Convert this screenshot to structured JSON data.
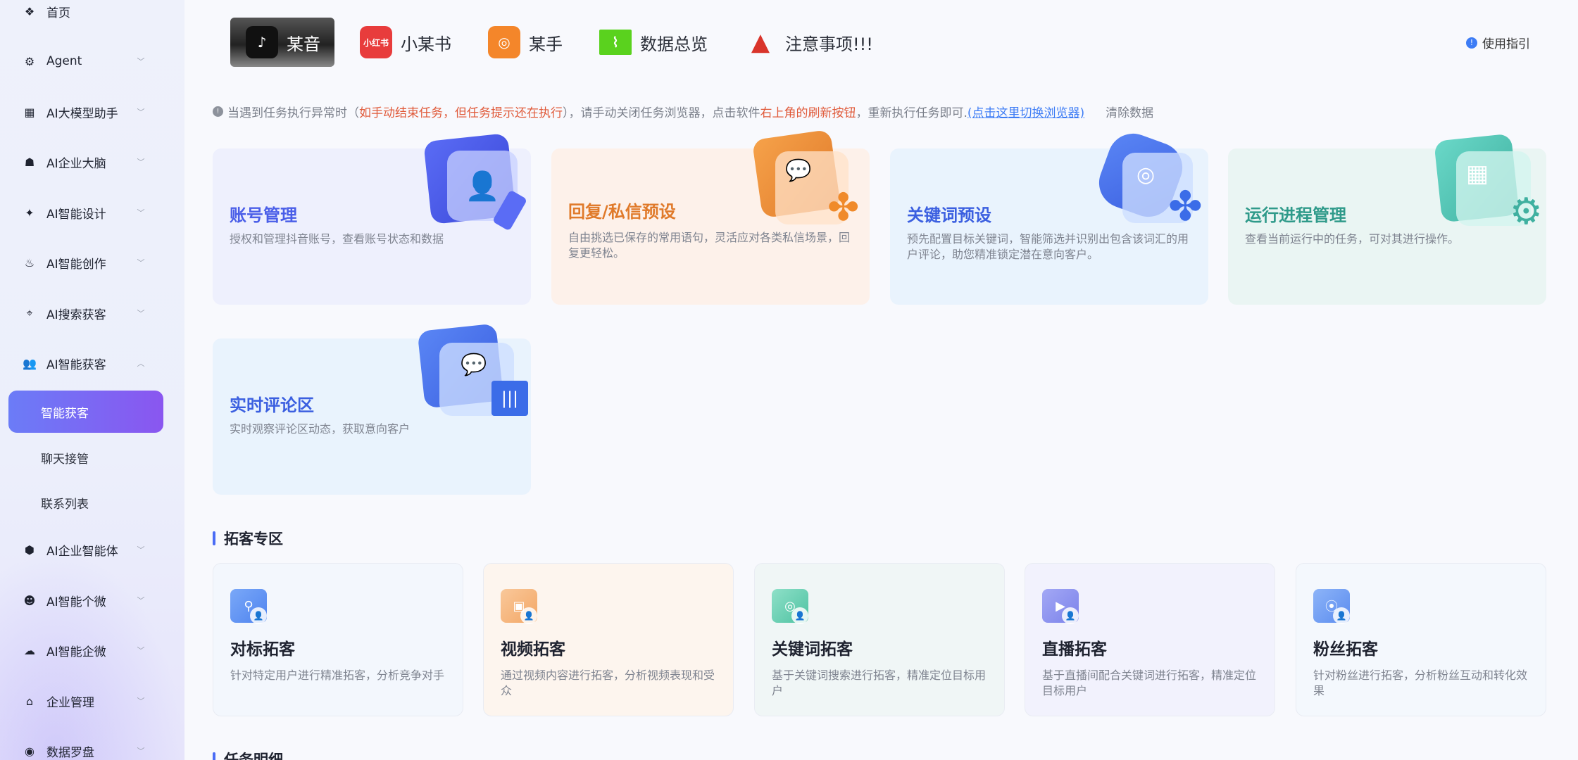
{
  "sidebar": {
    "items": [
      {
        "label": "首页",
        "icon": "diamond-grid-icon"
      },
      {
        "label": "Agent",
        "icon": "agent-icon"
      },
      {
        "label": "AI大模型助手",
        "icon": "grid-icon"
      },
      {
        "label": "AI企业大脑",
        "icon": "brain-icon"
      },
      {
        "label": "AI智能设计",
        "icon": "design-icon"
      },
      {
        "label": "AI智能创作",
        "icon": "flame-icon"
      },
      {
        "label": "AI搜索获客",
        "icon": "location-icon"
      },
      {
        "label": "AI智能获客",
        "icon": "users-icon"
      },
      {
        "label": "AI企业智能体",
        "icon": "robot-icon"
      },
      {
        "label": "AI智能个微",
        "icon": "chat-icon"
      },
      {
        "label": "AI智能企微",
        "icon": "chat-bubbles-icon"
      },
      {
        "label": "企业管理",
        "icon": "building-icon"
      },
      {
        "label": "数据罗盘",
        "icon": "compass-icon"
      }
    ],
    "sub_items": [
      "智能获客",
      "聊天接管",
      "联系列表"
    ]
  },
  "tabs": [
    {
      "label": "某音",
      "icon": "tiktok-icon",
      "color": "#111111"
    },
    {
      "label": "小某书",
      "icon": "xiaohongshu-icon",
      "icon_text": "小红书",
      "color": "#e83c3c"
    },
    {
      "label": "某手",
      "icon": "kuaishou-icon",
      "color": "#f4862a"
    },
    {
      "label": "数据总览",
      "icon": "monitor-chart-icon",
      "color": "#5ad21e"
    },
    {
      "label": "注意事项!!!",
      "icon": "warning-icon",
      "color": "#d9342b"
    }
  ],
  "guide_label": "使用指引",
  "notice": {
    "part1": "当遇到任务执行异常时（",
    "red1": "如手动结束任务，但任务提示还在执行",
    "part2": "），请手动关闭任务浏览器，点击软件",
    "red2": "右上角的刷新按钮",
    "part3": "，重新执行任务即可.",
    "link": "(点击这里切换浏览器)",
    "clear": "清除数据"
  },
  "feature_cards": [
    {
      "title": "账号管理",
      "desc": "授权和管理抖音账号，查看账号状态和数据",
      "color": "#4a5ee8"
    },
    {
      "title": "回复/私信预设",
      "desc": "自由挑选已保存的常用语句，灵活应对各类私信场景，回复更轻松。",
      "color": "#e07a2a"
    },
    {
      "title": "关键词预设",
      "desc": "预先配置目标关键词，智能筛选并识别出包含该词汇的用户评论，助您精准锁定潜在意向客户。",
      "color": "#3b5fe0"
    },
    {
      "title": "运行进程管理",
      "desc": "查看当前运行中的任务，可对其进行操作。",
      "color": "#2f9a8a"
    },
    {
      "title": "实时评论区",
      "desc": "实时观察评论区动态，获取意向客户",
      "color": "#3b5fe0"
    }
  ],
  "sections": {
    "tuoke_title": "拓客专区",
    "task_title": "任务明细"
  },
  "tuoke_cards": [
    {
      "title": "对标拓客",
      "desc": "针对特定用户进行精准拓客，分析竞争对手",
      "icon": "network-icon"
    },
    {
      "title": "视频拓客",
      "desc": "通过视频内容进行拓客，分析视频表现和受众",
      "icon": "film-icon"
    },
    {
      "title": "关键词拓客",
      "desc": "基于关键词搜索进行拓客，精准定位目标用户",
      "icon": "target-icon"
    },
    {
      "title": "直播拓客",
      "desc": "基于直播间配合关键词进行拓客，精准定位目标用户",
      "icon": "live-icon"
    },
    {
      "title": "粉丝拓客",
      "desc": "针对粉丝进行拓客，分析粉丝互动和转化效果",
      "icon": "broadcast-icon"
    }
  ]
}
